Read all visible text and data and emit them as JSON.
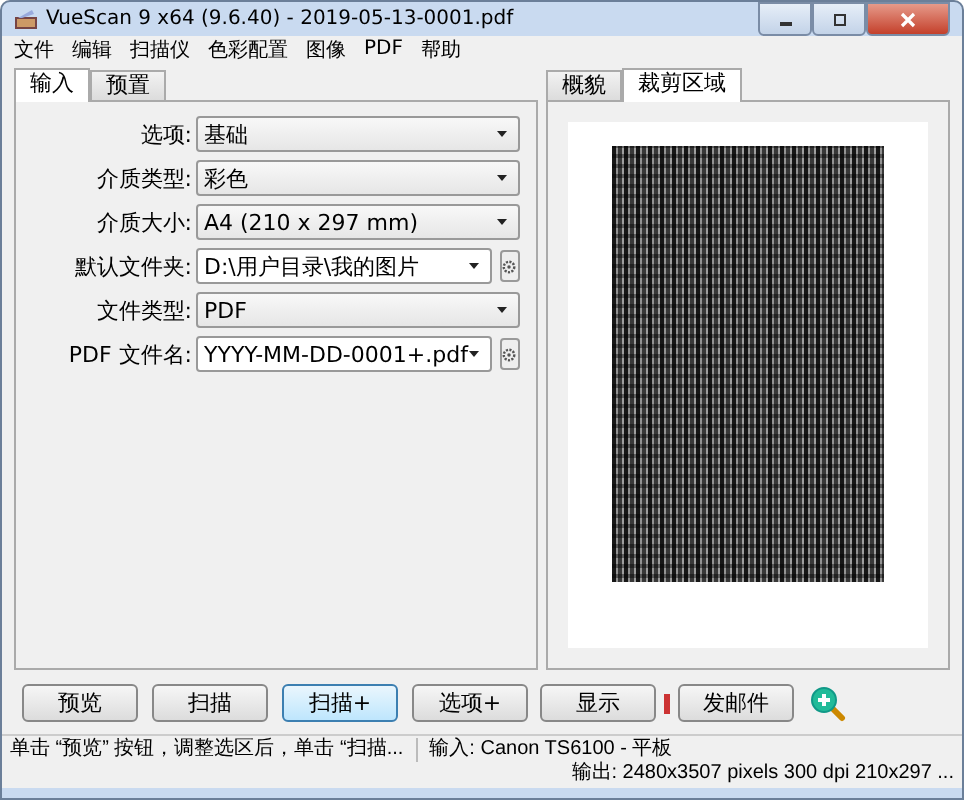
{
  "window": {
    "title": "VueScan 9 x64 (9.6.40) - 2019-05-13-0001.pdf"
  },
  "menu": [
    "文件",
    "编辑",
    "扫描仪",
    "色彩配置",
    "图像",
    "PDF",
    "帮助"
  ],
  "left_tabs": [
    {
      "label": "输入",
      "selected": true
    },
    {
      "label": "预置",
      "selected": false
    }
  ],
  "fields": [
    {
      "label": "选项:",
      "value": "基础",
      "kind": "dropdown"
    },
    {
      "label": "介质类型:",
      "value": "彩色",
      "kind": "dropdown"
    },
    {
      "label": "介质大小:",
      "value": "A4 (210 x 297 mm)",
      "kind": "dropdown"
    },
    {
      "label": "默认文件夹:",
      "value": "D:\\用户目录\\我的图片",
      "kind": "combo-browse"
    },
    {
      "label": "文件类型:",
      "value": "PDF",
      "kind": "dropdown"
    },
    {
      "label": "PDF 文件名:",
      "value": "YYYY-MM-DD-0001+.pdf",
      "kind": "combo-browse"
    }
  ],
  "right_tabs": [
    {
      "label": "概貌",
      "selected": false
    },
    {
      "label": "裁剪区域",
      "selected": true
    }
  ],
  "left_buttons": [
    {
      "label": "预览",
      "selected": false
    },
    {
      "label": "扫描",
      "selected": false
    },
    {
      "label": "扫描+",
      "selected": true
    },
    {
      "label": "选项+",
      "selected": false
    }
  ],
  "right_buttons": [
    "显示",
    "发邮件"
  ],
  "status_bar": [
    "单击 “预览” 按钮，调整选区后，单击 “扫描...",
    "输入: Canon TS6100 - 平板",
    "输出: 2480x3507 pixels 300 dpi 210x297 ..."
  ]
}
